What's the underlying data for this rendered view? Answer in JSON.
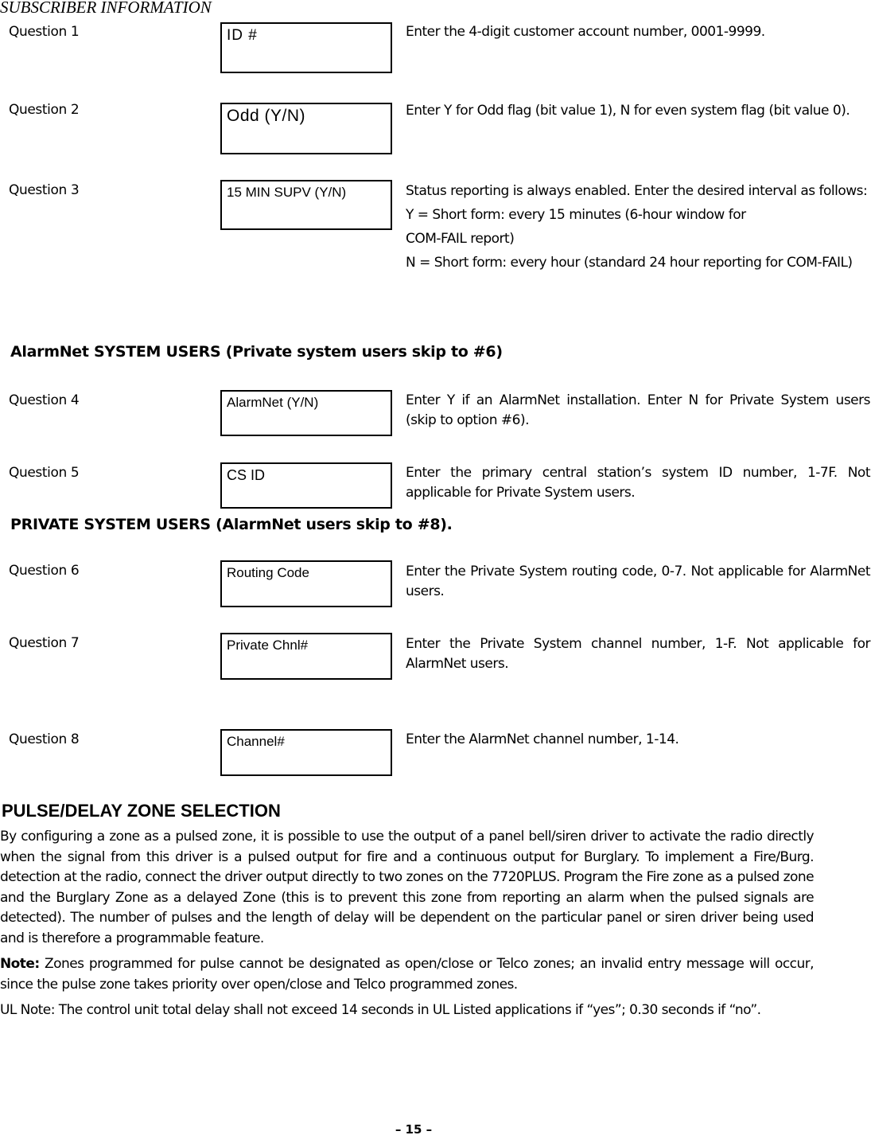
{
  "document": {
    "section_title": "SUBSCRIBER INFORMATION",
    "questions": [
      {
        "label": "Question 1",
        "field": "ID #",
        "description": [
          "Enter the 4-digit customer account number, 0001-9999."
        ]
      },
      {
        "label": "Question 2",
        "field": "Odd (Y/N)",
        "description": [
          "Enter Y for Odd flag (bit value 1), N for even system flag (bit value 0)."
        ]
      },
      {
        "label": "Question 3",
        "field": "15 MIN SUPV (Y/N)",
        "description": [
          "Status reporting is always enabled.  Enter the desired interval as follows:",
          "Y = Short form: every 15 minutes (6-hour window for",
          "COM-FAIL report)",
          "N = Short form: every hour (standard 24 hour reporting for COM-FAIL)"
        ]
      },
      {
        "label": "Question 4",
        "field": "AlarmNet (Y/N)",
        "description": [
          "Enter Y if an AlarmNet installation.  Enter N for Private System users (skip to option #6)."
        ]
      },
      {
        "label": "Question 5",
        "field": "CS ID",
        "description": [
          "Enter the primary central station’s system ID number, 1-7F. Not applicable for Private System users."
        ]
      },
      {
        "label": "Question 6",
        "field": "Routing Code",
        "description": [
          "Enter the Private System routing code, 0-7.  Not applicable for AlarmNet users."
        ]
      },
      {
        "label": "Question 7",
        "field": "Private Chnl#",
        "description": [
          "Enter the Private System channel number, 1-F.  Not applicable for AlarmNet users."
        ]
      },
      {
        "label": "Question 8",
        "field": "Channel#",
        "description": [
          "Enter the AlarmNet channel number, 1-14."
        ]
      }
    ],
    "alarmnet_heading": "AlarmNet SYSTEM USERS (Private system users skip to #6)",
    "private_heading": "PRIVATE SYSTEM USERS (AlarmNet users skip to #8).",
    "pulse_section": {
      "title": "PULSE/DELAY ZONE SELECTION",
      "paragraph": "By configuring a zone as a pulsed zone, it is possible to use the output of a panel bell/siren driver to activate the radio directly when the signal from this driver is a pulsed output for fire and a continuous output for Burglary.  To implement a Fire/Burg. detection at the radio, connect the driver output directly to two zones on the 7720PLUS.  Program the Fire zone as a pulsed zone and the Burglary Zone as a delayed Zone (this is to prevent this zone from reporting an alarm when the pulsed signals are detected). The number of pulses and the length of delay will be dependent on the particular panel or siren driver being used and is therefore a programmable feature.",
      "note_label": "Note:",
      "note_text": " Zones programmed for pulse cannot be designated as open/close or Telco zones; an invalid entry message will occur, since the pulse zone takes priority over open/close and Telco programmed zones.",
      "ul_note": "UL Note: The control unit total delay shall not exceed 14 seconds in UL Listed applications if “yes”; 0.30 seconds if “no”."
    },
    "page_number": "– 15 –"
  }
}
